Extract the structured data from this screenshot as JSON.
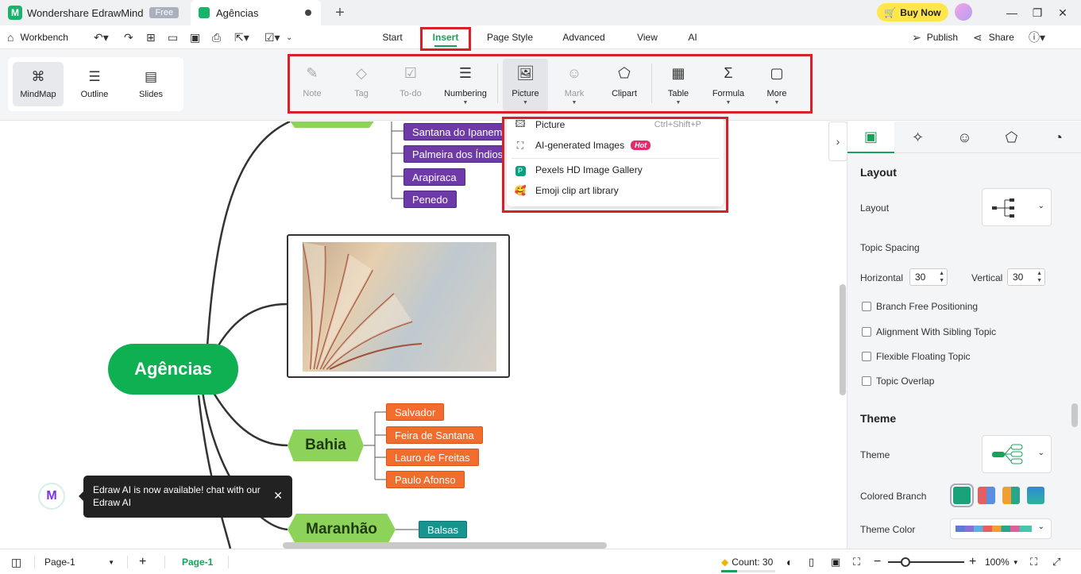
{
  "titlebar": {
    "app_name": "Wondershare EdrawMind",
    "app_logo_letter": "M",
    "plan_badge": "Free",
    "doc_tab": "Agências",
    "buy_now": "Buy Now"
  },
  "menubar": {
    "workbench": "Workbench",
    "tabs": [
      "Start",
      "Insert",
      "Page Style",
      "Advanced",
      "View",
      "AI"
    ],
    "active_tab": "Insert",
    "publish": "Publish",
    "share": "Share"
  },
  "views": {
    "mindmap": "MindMap",
    "outline": "Outline",
    "slides": "Slides"
  },
  "ribbon": {
    "note": "Note",
    "tag": "Tag",
    "todo": "To-do",
    "numbering": "Numbering",
    "picture": "Picture",
    "mark": "Mark",
    "clipart": "Clipart",
    "table": "Table",
    "formula": "Formula",
    "more": "More"
  },
  "dropdown": {
    "picture": "Picture",
    "picture_shortcut": "Ctrl+Shift+P",
    "ai_images": "AI-generated Images",
    "hot": "Hot",
    "pexels": "Pexels HD Image Gallery",
    "emoji": "Emoji clip art library"
  },
  "mindmap": {
    "central": "Agências",
    "top_group": [
      "Santana do Ipanema",
      "Palmeira dos Índios",
      "Arapiraca",
      "Penedo"
    ],
    "bahia": "Bahia",
    "bahia_children": [
      "Salvador",
      "Feira de Santana",
      "Lauro de Freitas",
      "Paulo Afonso"
    ],
    "maranhao": "Maranhão",
    "maranhao_children": [
      "Balsas"
    ]
  },
  "ai_tip": {
    "badge": "M",
    "text": "Edraw AI is now available!  chat with our Edraw AI"
  },
  "panel": {
    "layout_heading": "Layout",
    "layout_label": "Layout",
    "topic_spacing": "Topic Spacing",
    "horizontal_label": "Horizontal",
    "horizontal_value": "30",
    "vertical_label": "Vertical",
    "vertical_value": "30",
    "checks": [
      "Branch Free Positioning",
      "Alignment With Sibling Topic",
      "Flexible Floating Topic",
      "Topic Overlap"
    ],
    "theme_heading": "Theme",
    "theme_label": "Theme",
    "colored_branch": "Colored Branch",
    "theme_color": "Theme Color"
  },
  "statusbar": {
    "page_select": "Page-1",
    "page_tab": "Page-1",
    "count": "Count: 30",
    "zoom": "100%"
  },
  "colors": {
    "accent": "#19a05a",
    "highlight": "#d8202a",
    "purple_topic": "#6d3aa8",
    "orange_topic": "#f26d2d",
    "teal_topic": "#17948d",
    "central": "#0eb052",
    "main_topic": "#8dd35a"
  }
}
